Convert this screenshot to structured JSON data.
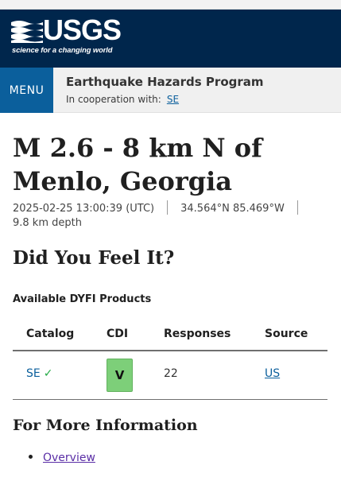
{
  "header": {
    "logo_text": "USGS",
    "logo_tagline": "science for a changing world"
  },
  "site_bar": {
    "menu_label": "MENU",
    "title": "Earthquake Hazards Program",
    "cooperation_label": "In cooperation with:",
    "cooperation_link": "SE"
  },
  "event": {
    "title": "M 2.6 - 8 km N of Menlo, Georgia",
    "time": "2025-02-25 13:00:39 (UTC)",
    "location": "34.564°N 85.469°W",
    "depth": "9.8 km depth"
  },
  "dyfi": {
    "heading": "Did You Feel It?",
    "products_heading": "Available DYFI Products",
    "columns": [
      "Catalog",
      "CDI",
      "Responses",
      "Source"
    ],
    "rows": [
      {
        "catalog": "SE",
        "cdi": "V",
        "responses": "22",
        "source": "US",
        "cdi_color": "#7dcf79"
      }
    ]
  },
  "more_info": {
    "heading": "For More Information",
    "links": [
      "Overview"
    ]
  },
  "colors": {
    "header_bg": "#00264c",
    "menu_bg": "#0b5f9c",
    "link": "#0b5f9c",
    "visited_link": "#5a2ea6",
    "cdi_v": "#7dcf79",
    "check": "#22aa44"
  }
}
